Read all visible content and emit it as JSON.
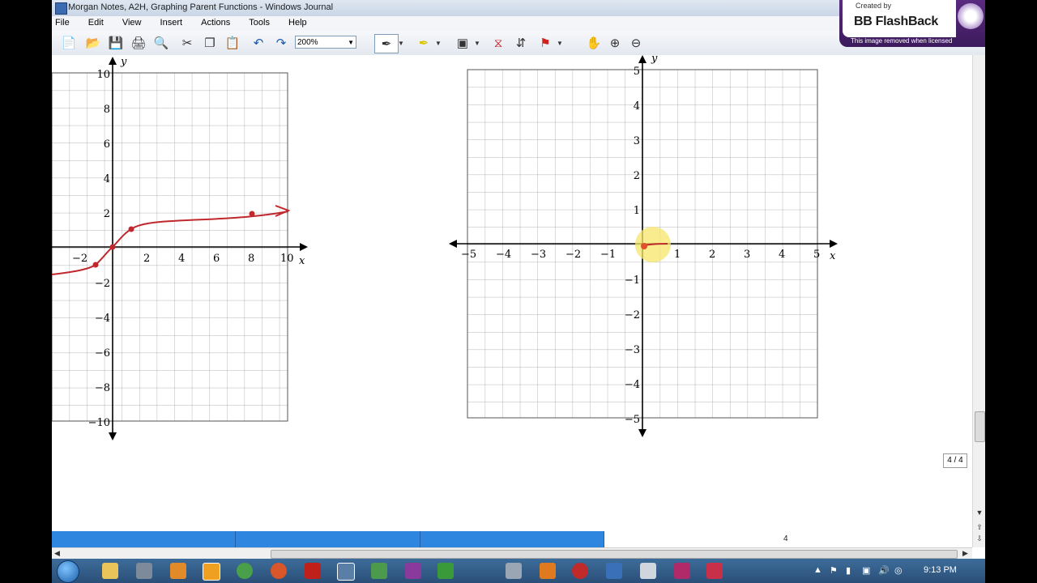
{
  "window": {
    "title": "Morgan Notes, A2H, Graphing Parent Functions - Windows Journal"
  },
  "menu": [
    "File",
    "Edit",
    "View",
    "Insert",
    "Actions",
    "Tools",
    "Help"
  ],
  "toolbar": {
    "zoom": "200%"
  },
  "watermark": {
    "created_by": "Created by",
    "brand": "BB FlashBack",
    "note": "This image removed when licensed"
  },
  "graph_left": {
    "x_label": "x",
    "y_label": "y",
    "x_ticks": [
      "−2",
      "2",
      "4",
      "6",
      "8",
      "10"
    ],
    "y_ticks_pos": [
      "10",
      "8",
      "6",
      "4",
      "2"
    ],
    "y_ticks_neg": [
      "−2",
      "−4",
      "−6",
      "−8",
      "−10"
    ]
  },
  "graph_right": {
    "x_label": "x",
    "y_label": "y",
    "x_ticks": [
      "−5",
      "−4",
      "−3",
      "−2",
      "−1",
      "1",
      "2",
      "3",
      "4",
      "5"
    ],
    "y_ticks": [
      "5",
      "4",
      "3",
      "2",
      "1",
      "−1",
      "−2",
      "−3",
      "−4",
      "−5"
    ]
  },
  "status": {
    "page_indicator": "4 / 4",
    "page_number": "4"
  },
  "taskbar": {
    "time": "9:13 PM"
  },
  "colors": {
    "ink": "#c0282d",
    "highlight": "#f6e66a",
    "tabs": "#2e86de"
  }
}
